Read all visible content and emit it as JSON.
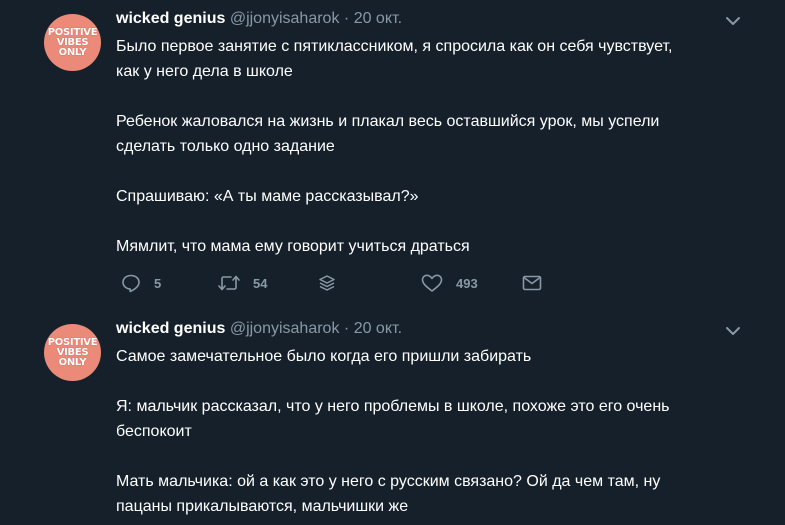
{
  "tweets": [
    {
      "avatar_text": "POSITIVE\nVIBES\nONLY",
      "name": "wicked genius",
      "handle": "@jjonyisaharok",
      "separator": "·",
      "date": "20 окт.",
      "paragraphs": [
        "Было первое занятие с пятиклассником, я спросила как он себя чувствует,\nкак у него дела в школе",
        "Ребенок жаловался на жизнь и плакал весь оставшийся урок, мы успели\nсделать только одно задание",
        "Спрашиваю: «А ты маме рассказывал?»",
        "Мямлит, что мама ему говорит учиться драться"
      ],
      "actions": {
        "replies": "5",
        "retweets": "54",
        "likes": "493"
      }
    },
    {
      "avatar_text": "POSITIVE\nVIBES\nONLY",
      "name": "wicked genius",
      "handle": "@jjonyisaharok",
      "separator": "·",
      "date": "20 окт.",
      "paragraphs": [
        "Самое замечательное было когда его пришли забирать",
        "Я: мальчик рассказал, что у него проблемы в школе, похоже это его очень\nбеспокоит",
        "Мать мальчика: ой а как это у него с русским связано? Ой да чем там, ну\nпацаны прикалываются, мальчишки же"
      ]
    }
  ],
  "icons": {
    "more": "chevron-down-icon",
    "reply": "reply-icon",
    "retweet": "retweet-icon",
    "stack": "stack-icon",
    "like": "heart-icon",
    "dm": "envelope-icon"
  },
  "colors": {
    "background": "#15202b",
    "text": "#ffffff",
    "secondary": "#8899a6",
    "avatar": "#ec8a7a"
  }
}
